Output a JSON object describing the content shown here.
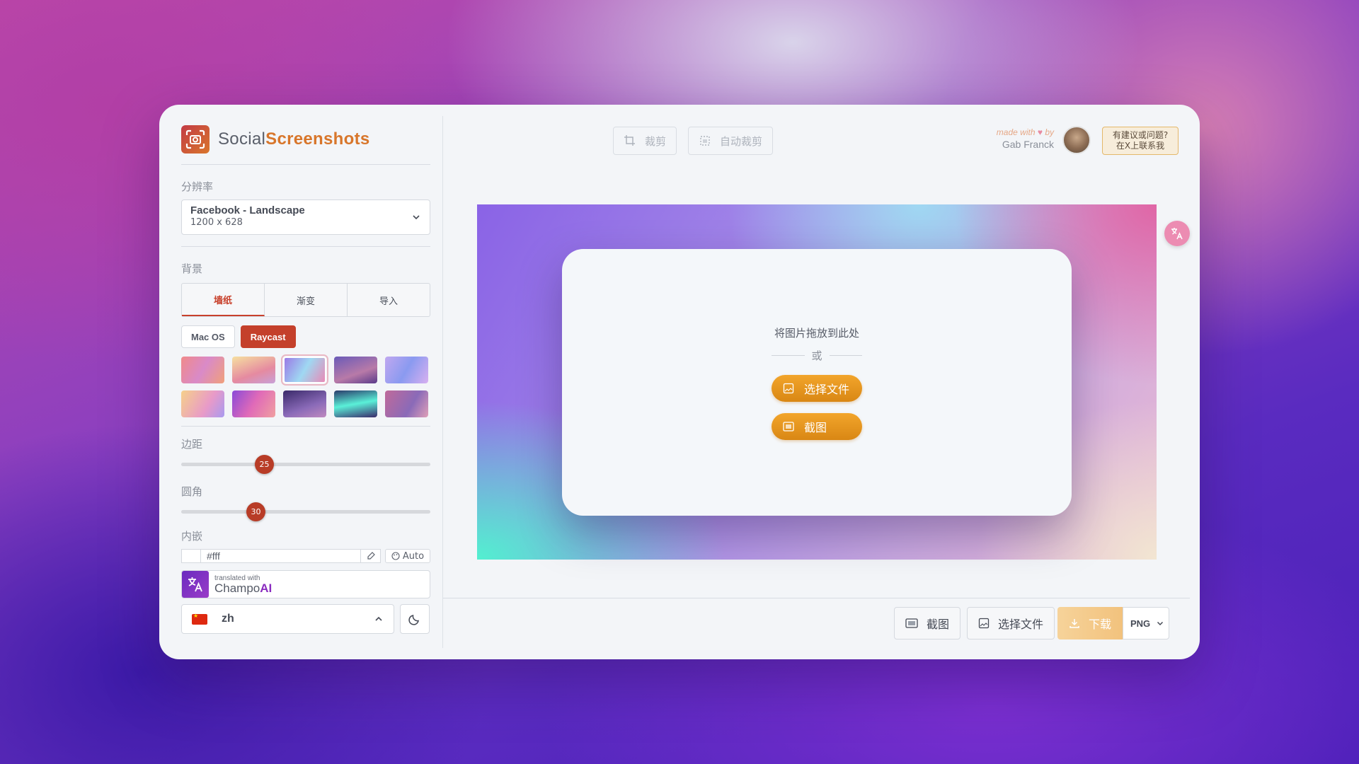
{
  "app": {
    "name_part1": "Social",
    "name_part2": "Screenshots"
  },
  "sidebar": {
    "resolution_label": "分辨率",
    "resolution": {
      "name": "Facebook - Landscape",
      "size": "1200 x 628"
    },
    "background_label": "背景",
    "bg_tabs": [
      {
        "label": "墙纸",
        "active": true
      },
      {
        "label": "渐变",
        "active": false
      },
      {
        "label": "导入",
        "active": false
      }
    ],
    "wallpaper_sets": [
      {
        "label": "Mac OS",
        "active": false
      },
      {
        "label": "Raycast",
        "active": true
      }
    ],
    "padding_label": "边距",
    "padding_value": "25",
    "radius_label": "圆角",
    "radius_value": "30",
    "inset_label": "内嵌",
    "inset_color": "#fff",
    "inset_auto": "Auto",
    "champo_small": "translated with",
    "champo_name": "Champo",
    "champo_ai": "AI",
    "lang_code": "zh"
  },
  "toolbar": {
    "crop": "裁剪",
    "auto_crop": "自动裁剪"
  },
  "credit": {
    "made_with": "made with",
    "by": "by",
    "author": "Gab Franck"
  },
  "feedback": {
    "line1": "有建议或问题?",
    "line2": "在X上联系我"
  },
  "canvas": {
    "drop_text": "将图片拖放到此处",
    "or": "或",
    "choose_file": "选择文件",
    "screenshot": "截图"
  },
  "bottom": {
    "screenshot": "截图",
    "choose_file": "选择文件",
    "download": "下载",
    "format": "PNG"
  },
  "colors": {
    "accent": "#c4402b",
    "orange": "#e6951f"
  }
}
